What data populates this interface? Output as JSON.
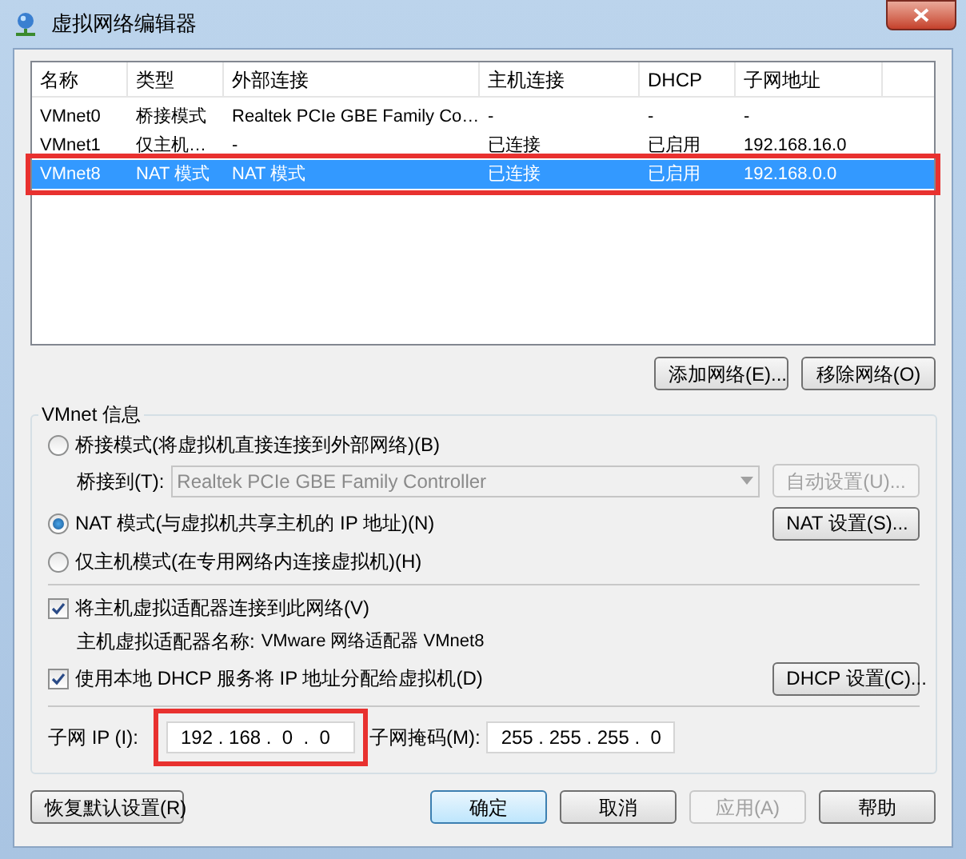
{
  "window": {
    "title": "虚拟网络编辑器"
  },
  "table": {
    "columns": [
      "名称",
      "类型",
      "外部连接",
      "主机连接",
      "DHCP",
      "子网地址"
    ],
    "rows": [
      {
        "cells": [
          "VMnet0",
          "桥接模式",
          "Realtek PCIe GBE Family Co…",
          "-",
          "-",
          "-"
        ],
        "selected": false,
        "highlighted": false
      },
      {
        "cells": [
          "VMnet1",
          "仅主机…",
          "-",
          "已连接",
          "已启用",
          "192.168.16.0"
        ],
        "selected": false,
        "highlighted": false
      },
      {
        "cells": [
          "VMnet8",
          "NAT 模式",
          "NAT 模式",
          "已连接",
          "已启用",
          "192.168.0.0"
        ],
        "selected": true,
        "highlighted": true
      }
    ]
  },
  "table_buttons": [
    "添加网络(E)...",
    "移除网络(O)"
  ],
  "vmnet_info": {
    "title": "VMnet 信息",
    "modes": [
      {
        "label": "桥接模式(将虚拟机直接连接到外部网络)(B)",
        "selected": false
      },
      {
        "label": "NAT 模式(与虚拟机共享主机的 IP 地址)(N)",
        "selected": true
      },
      {
        "label": "仅主机模式(在专用网络内连接虚拟机)(H)",
        "selected": false
      }
    ],
    "bridge_label": "桥接到(T):",
    "bridge_value": "Realtek PCIe GBE Family Controller",
    "bridge_disabled": true,
    "auto_button": {
      "label": "自动设置(U)...",
      "disabled": true
    },
    "nat_button": "NAT 设置(S)...",
    "connect_adapter": {
      "label": "将主机虚拟适配器连接到此网络(V)",
      "checked": true
    },
    "adapter_name_label": "主机虚拟适配器名称:",
    "adapter_name": "VMware 网络适配器 VMnet8",
    "use_dhcp": {
      "label": "使用本地 DHCP 服务将 IP 地址分配给虚拟机(D)",
      "checked": true
    },
    "dhcp_button": "DHCP 设置(C)...",
    "subnet_ip_label": "子网 IP (I):",
    "subnet_ip": "192 . 168 .  0  .  0",
    "subnet_ip_highlighted": true,
    "subnet_mask_label": "子网掩码(M):",
    "subnet_mask": "255 . 255 . 255 .  0"
  },
  "buttons": [
    {
      "label": "恢复默认设置(R)",
      "disabled": false,
      "default": false
    },
    {
      "label": "确定",
      "disabled": false,
      "default": true
    },
    {
      "label": "取消",
      "disabled": false,
      "default": false
    },
    {
      "label": "应用(A)",
      "disabled": true,
      "default": false
    },
    {
      "label": "帮助",
      "disabled": false,
      "default": false
    }
  ]
}
